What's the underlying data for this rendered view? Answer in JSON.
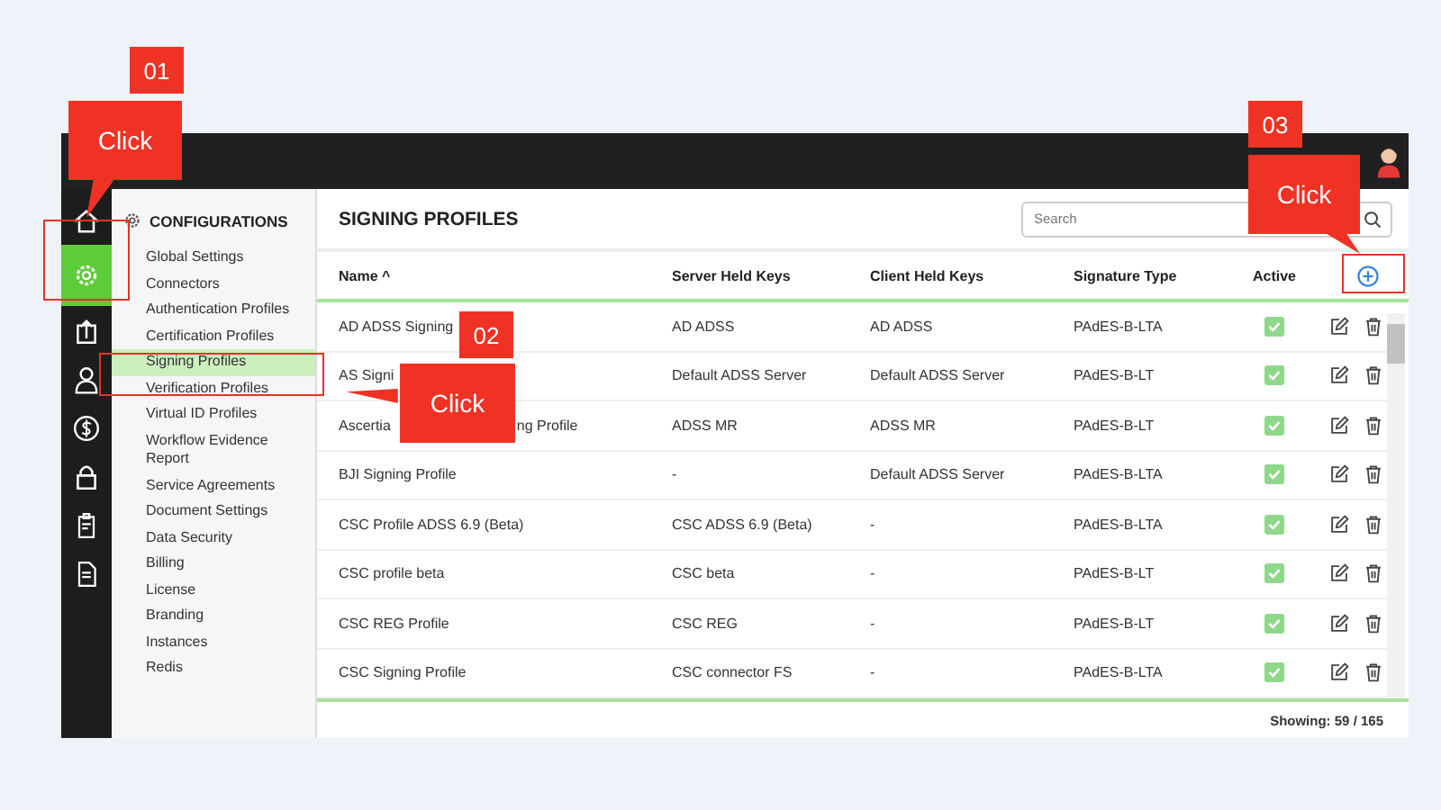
{
  "config_menu": {
    "title": "CONFIGURATIONS",
    "items": [
      {
        "label": "Global Settings",
        "selected": false
      },
      {
        "label": "Connectors",
        "selected": false
      },
      {
        "label": "Authentication Profiles",
        "selected": false
      },
      {
        "label": "Certification Profiles",
        "selected": false
      },
      {
        "label": "Signing Profiles",
        "selected": true
      },
      {
        "label": "Verification Profiles",
        "selected": false
      },
      {
        "label": "Virtual ID Profiles",
        "selected": false
      },
      {
        "label": "Workflow Evidence Report",
        "selected": false
      },
      {
        "label": "Service Agreements",
        "selected": false
      },
      {
        "label": "Document Settings",
        "selected": false
      },
      {
        "label": "Data Security",
        "selected": false
      },
      {
        "label": "Billing",
        "selected": false
      },
      {
        "label": "License",
        "selected": false
      },
      {
        "label": "Branding",
        "selected": false
      },
      {
        "label": "Instances",
        "selected": false
      },
      {
        "label": "Redis",
        "selected": false
      }
    ]
  },
  "nav_icons": [
    {
      "kind": "home",
      "selected": false
    },
    {
      "kind": "gear",
      "selected": true
    },
    {
      "kind": "upload",
      "selected": false
    },
    {
      "kind": "user",
      "selected": false
    },
    {
      "kind": "dollar",
      "selected": false
    },
    {
      "kind": "lock",
      "selected": false
    },
    {
      "kind": "clipboard",
      "selected": false
    },
    {
      "kind": "document",
      "selected": false
    }
  ],
  "page_title": "SIGNING PROFILES",
  "search": {
    "placeholder": "Search"
  },
  "table": {
    "columns": [
      "Name ^",
      "Server Held Keys",
      "Client Held Keys",
      "Signature Type",
      "Active"
    ],
    "rows": [
      {
        "name": "AD ADSS Signing",
        "server": "AD ADSS",
        "client": "AD ADSS",
        "type": "PAdES-B-LTA",
        "active": true
      },
      {
        "name": "AS Signi",
        "server": "Default ADSS Server",
        "client": "Default ADSS Server",
        "type": "PAdES-B-LT",
        "active": true
      },
      {
        "name": "Ascertia",
        "name_end": "ng Profile",
        "server": "ADSS MR",
        "client": "ADSS MR",
        "type": "PAdES-B-LT",
        "active": true
      },
      {
        "name": "BJI Signing Profile",
        "server": "-",
        "client": "Default ADSS Server",
        "type": "PAdES-B-LTA",
        "active": true
      },
      {
        "name": "CSC Profile ADSS 6.9 (Beta)",
        "server": "CSC ADSS 6.9 (Beta)",
        "client": "-",
        "type": "PAdES-B-LTA",
        "active": true
      },
      {
        "name": "CSC profile beta",
        "server": "CSC beta",
        "client": "-",
        "type": "PAdES-B-LT",
        "active": true
      },
      {
        "name": "CSC REG Profile",
        "server": "CSC REG",
        "client": "-",
        "type": "PAdES-B-LT",
        "active": true
      },
      {
        "name": "CSC Signing Profile",
        "server": "CSC connector FS",
        "client": "-",
        "type": "PAdES-B-LTA",
        "active": true
      }
    ]
  },
  "footer": "Showing: 59 / 165",
  "callouts": [
    {
      "step": "01",
      "label": "Click"
    },
    {
      "step": "02",
      "label": "Click"
    },
    {
      "step": "03",
      "label": "Click"
    }
  ]
}
